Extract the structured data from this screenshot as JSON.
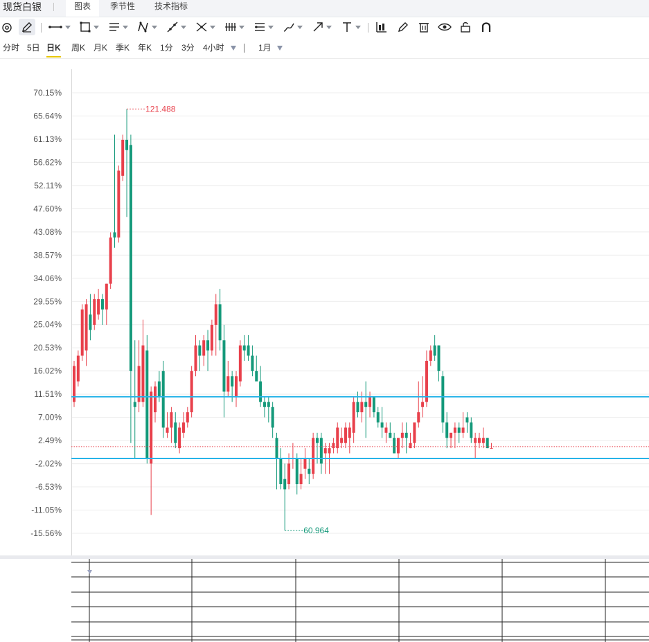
{
  "app": {
    "title": "现货白银",
    "tabs": [
      {
        "label": "图表",
        "active": true
      },
      {
        "label": "季节性",
        "active": false
      },
      {
        "label": "技术指标",
        "active": false
      }
    ]
  },
  "toolbar": {
    "icons": [
      "hide-drawings-icon",
      "pencil-icon",
      "horizontal-line-icon",
      "rectangle-icon",
      "parallel-channel-icon",
      "pattern-icon",
      "trend-line-icon",
      "fibonacci-icon",
      "gann-icon",
      "price-range-icon",
      "brush-icon",
      "arrow-icon",
      "text-icon",
      "bar-chart-icon",
      "edit-icon",
      "trash-icon",
      "eye-icon",
      "unlock-icon",
      "magnet-icon"
    ]
  },
  "periods": {
    "items": [
      {
        "label": "分时",
        "active": false
      },
      {
        "label": "5日",
        "active": false
      },
      {
        "label": "日K",
        "active": true
      },
      {
        "label": "周K",
        "active": false
      },
      {
        "label": "月K",
        "active": false
      },
      {
        "label": "季K",
        "active": false
      },
      {
        "label": "年K",
        "active": false
      },
      {
        "label": "1分",
        "active": false
      },
      {
        "label": "3分",
        "active": false
      },
      {
        "label": "4小时",
        "active": false
      }
    ],
    "range_label": "1月"
  },
  "colors": {
    "up": "#e8404b",
    "down": "#14997a",
    "level_line": "#27b3e8",
    "high_label": "#e8404b",
    "low_label": "#14997a",
    "grid": "#ececec"
  },
  "chart_data": {
    "type": "candlestick",
    "y_tick_labels": [
      "70.15%",
      "65.64%",
      "61.13%",
      "56.62%",
      "52.11%",
      "47.60%",
      "43.08%",
      "38.57%",
      "34.06%",
      "29.55%",
      "25.04%",
      "20.53%",
      "16.02%",
      "11.51%",
      "7.00%",
      "2.49%",
      "-2.02%",
      "-6.53%",
      "-11.05%",
      "-15.56%"
    ],
    "ylim": [
      -15.56,
      70.15
    ],
    "high_label": "121.488",
    "low_label": "60.964",
    "horizontal_levels": [
      11.0,
      -1.0
    ],
    "reference_level": 1.3,
    "candles": [
      {
        "o": 10,
        "h": 18,
        "l": 9,
        "c": 17
      },
      {
        "o": 14,
        "h": 20,
        "l": 13,
        "c": 19
      },
      {
        "o": 19,
        "h": 29,
        "l": 18,
        "c": 28
      },
      {
        "o": 20,
        "h": 30,
        "l": 17,
        "c": 29
      },
      {
        "o": 27,
        "h": 31,
        "l": 22,
        "c": 24
      },
      {
        "o": 25,
        "h": 31,
        "l": 24,
        "c": 30
      },
      {
        "o": 27,
        "h": 32,
        "l": 26,
        "c": 30
      },
      {
        "o": 30,
        "h": 31,
        "l": 25,
        "c": 28
      },
      {
        "o": 28,
        "h": 33,
        "l": 25,
        "c": 33
      },
      {
        "o": 33,
        "h": 43,
        "l": 32,
        "c": 42
      },
      {
        "o": 43,
        "h": 62,
        "l": 40,
        "c": 42
      },
      {
        "o": 42,
        "h": 56,
        "l": 41,
        "c": 55
      },
      {
        "o": 54,
        "h": 62,
        "l": 53,
        "c": 61
      },
      {
        "o": 61,
        "h": 67,
        "l": 46,
        "c": 59
      },
      {
        "o": 60,
        "h": 62,
        "l": 2,
        "c": 16
      },
      {
        "o": 10,
        "h": 22,
        "l": -1,
        "c": 9
      },
      {
        "o": 10,
        "h": 22,
        "l": 8,
        "c": 17
      },
      {
        "o": 10,
        "h": 26,
        "l": 9,
        "c": 21
      },
      {
        "o": 20,
        "h": 23,
        "l": -2,
        "c": -1
      },
      {
        "o": -2,
        "h": 13,
        "l": -12,
        "c": 12
      },
      {
        "o": 8,
        "h": 14,
        "l": 6,
        "c": 13
      },
      {
        "o": 14,
        "h": 16,
        "l": 10,
        "c": 11
      },
      {
        "o": 16,
        "h": 18,
        "l": 3,
        "c": 5
      },
      {
        "o": 4,
        "h": 8,
        "l": 3,
        "c": 5
      },
      {
        "o": 5,
        "h": 9,
        "l": 2,
        "c": 8
      },
      {
        "o": 6,
        "h": 8,
        "l": 1,
        "c": 2
      },
      {
        "o": 1,
        "h": 6,
        "l": 0,
        "c": 5
      },
      {
        "o": 4,
        "h": 8,
        "l": 3,
        "c": 6
      },
      {
        "o": 6,
        "h": 9,
        "l": 5,
        "c": 8
      },
      {
        "o": 8,
        "h": 17,
        "l": 7,
        "c": 16
      },
      {
        "o": 16,
        "h": 23,
        "l": 15,
        "c": 21
      },
      {
        "o": 21,
        "h": 22,
        "l": 16,
        "c": 19
      },
      {
        "o": 19,
        "h": 23,
        "l": 17,
        "c": 22
      },
      {
        "o": 22,
        "h": 24,
        "l": 16,
        "c": 20
      },
      {
        "o": 20,
        "h": 26,
        "l": 19,
        "c": 25
      },
      {
        "o": 25,
        "h": 31,
        "l": 19,
        "c": 29
      },
      {
        "o": 29,
        "h": 32,
        "l": 20,
        "c": 22
      },
      {
        "o": 22,
        "h": 25,
        "l": 7,
        "c": 12
      },
      {
        "o": 12,
        "h": 18,
        "l": 11,
        "c": 15
      },
      {
        "o": 15,
        "h": 16,
        "l": 10,
        "c": 13
      },
      {
        "o": 11,
        "h": 16,
        "l": 9,
        "c": 15
      },
      {
        "o": 14,
        "h": 22,
        "l": 13,
        "c": 21
      },
      {
        "o": 21,
        "h": 23,
        "l": 18,
        "c": 20
      },
      {
        "o": 21,
        "h": 23,
        "l": 18,
        "c": 19
      },
      {
        "o": 19,
        "h": 21,
        "l": 15,
        "c": 16
      },
      {
        "o": 16,
        "h": 19,
        "l": 15,
        "c": 14
      },
      {
        "o": 14,
        "h": 17,
        "l": 9,
        "c": 10
      },
      {
        "o": 10,
        "h": 11,
        "l": 7,
        "c": 9
      },
      {
        "o": 10,
        "h": 11,
        "l": 6,
        "c": 9
      },
      {
        "o": 9,
        "h": 10,
        "l": 3,
        "c": 5
      },
      {
        "o": 3,
        "h": 4,
        "l": -7,
        "c": -1
      },
      {
        "o": -1,
        "h": 1,
        "l": -7,
        "c": -6
      },
      {
        "o": -5,
        "h": -2,
        "l": -15,
        "c": -7
      },
      {
        "o": -6,
        "h": 0,
        "l": -7,
        "c": -2
      },
      {
        "o": -1,
        "h": 2,
        "l": -3,
        "c": -1
      },
      {
        "o": -1,
        "h": 0,
        "l": -8,
        "c": -6
      },
      {
        "o": -6,
        "h": -1,
        "l": -7,
        "c": -4
      },
      {
        "o": -3,
        "h": 1,
        "l": -5,
        "c": -1
      },
      {
        "o": -3,
        "h": -1,
        "l": -6,
        "c": -4
      },
      {
        "o": -4,
        "h": 4,
        "l": -5,
        "c": 3
      },
      {
        "o": 3,
        "h": 4,
        "l": -2,
        "c": 2
      },
      {
        "o": 3,
        "h": 4,
        "l": -4,
        "c": -2
      },
      {
        "o": 0,
        "h": 2,
        "l": -4,
        "c": 1
      },
      {
        "o": 0,
        "h": 2,
        "l": -4,
        "c": 1
      },
      {
        "o": 1,
        "h": 3,
        "l": 0,
        "c": 2
      },
      {
        "o": 1,
        "h": 6,
        "l": 0,
        "c": 5
      },
      {
        "o": 2,
        "h": 5,
        "l": 1,
        "c": 3
      },
      {
        "o": 2,
        "h": 6,
        "l": 1,
        "c": 5
      },
      {
        "o": 3,
        "h": 6,
        "l": 0,
        "c": 5
      },
      {
        "o": 4,
        "h": 11,
        "l": 2,
        "c": 10
      },
      {
        "o": 10,
        "h": 12,
        "l": 7,
        "c": 8
      },
      {
        "o": 8,
        "h": 12,
        "l": 6,
        "c": 10
      },
      {
        "o": 10,
        "h": 14,
        "l": 3,
        "c": 9
      },
      {
        "o": 9,
        "h": 12,
        "l": 7,
        "c": 11
      },
      {
        "o": 11,
        "h": 11,
        "l": 7,
        "c": 8
      },
      {
        "o": 8,
        "h": 9,
        "l": 5,
        "c": 6
      },
      {
        "o": 6,
        "h": 9,
        "l": 3,
        "c": 5
      },
      {
        "o": 4,
        "h": 6,
        "l": 2,
        "c": 5
      },
      {
        "o": 4,
        "h": 6,
        "l": 3,
        "c": 3
      },
      {
        "o": 3,
        "h": 4,
        "l": 0,
        "c": 0
      },
      {
        "o": 0,
        "h": 3,
        "l": -1,
        "c": 3
      },
      {
        "o": 3,
        "h": 6,
        "l": 1,
        "c": 4
      },
      {
        "o": 4,
        "h": 6,
        "l": 0,
        "c": 3
      },
      {
        "o": 1,
        "h": 4,
        "l": 1,
        "c": 2
      },
      {
        "o": 2,
        "h": 6,
        "l": 1,
        "c": 6
      },
      {
        "o": 6,
        "h": 14,
        "l": 5,
        "c": 8
      },
      {
        "o": 9,
        "h": 15,
        "l": 7,
        "c": 10
      },
      {
        "o": 10,
        "h": 20,
        "l": 9,
        "c": 18
      },
      {
        "o": 18,
        "h": 21,
        "l": 17,
        "c": 20
      },
      {
        "o": 21,
        "h": 23,
        "l": 18,
        "c": 19
      },
      {
        "o": 21,
        "h": 21,
        "l": 14,
        "c": 16
      },
      {
        "o": 15,
        "h": 16,
        "l": 4,
        "c": 6
      },
      {
        "o": 6,
        "h": 8,
        "l": 1,
        "c": 3
      },
      {
        "o": 3,
        "h": 4,
        "l": 1,
        "c": 4
      },
      {
        "o": 4,
        "h": 6,
        "l": 1,
        "c": 5
      },
      {
        "o": 5,
        "h": 6,
        "l": 2,
        "c": 4
      },
      {
        "o": 4,
        "h": 8,
        "l": 3,
        "c": 5
      },
      {
        "o": 7,
        "h": 8,
        "l": 4,
        "c": 6
      },
      {
        "o": 6,
        "h": 7,
        "l": 2,
        "c": 3
      },
      {
        "o": 2,
        "h": 4,
        "l": -1,
        "c": 3
      },
      {
        "o": 2,
        "h": 4,
        "l": 1,
        "c": 3
      },
      {
        "o": 2,
        "h": 5,
        "l": 1,
        "c": 3
      },
      {
        "o": 3,
        "h": 3,
        "l": 1,
        "c": 1
      },
      {
        "o": 1,
        "h": 2,
        "l": 1,
        "c": 1
      }
    ]
  }
}
